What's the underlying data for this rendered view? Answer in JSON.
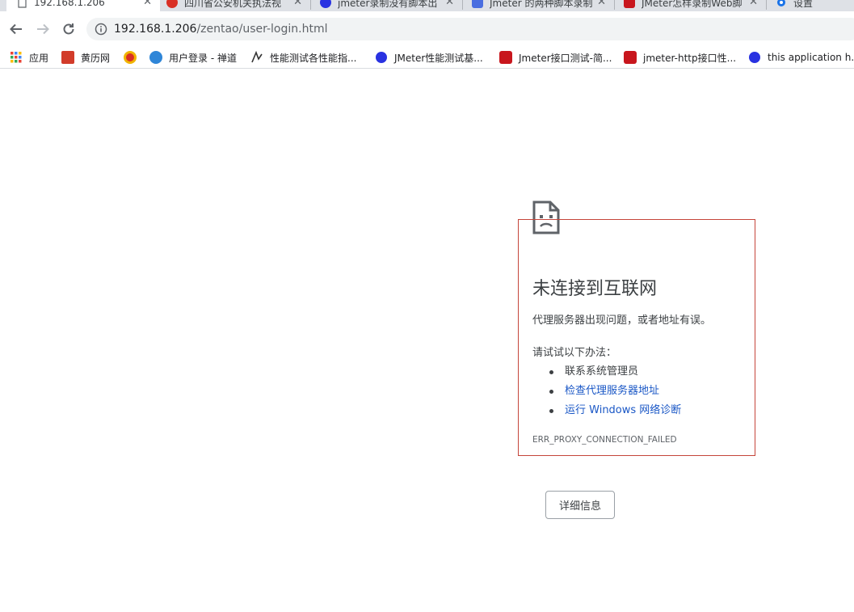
{
  "tabs": [
    {
      "title": "192.168.1.206",
      "icon": "page-icon",
      "active": true
    },
    {
      "title": "四川省公安机关执法视",
      "icon": "police-badge-icon",
      "active": false
    },
    {
      "title": "jmeter录制没有脚本出",
      "icon": "baidu-paw-icon",
      "active": false
    },
    {
      "title": "Jmeter 的两种脚本录制",
      "icon": "blog-icon",
      "active": false
    },
    {
      "title": "JMeter怎样录制Web脚",
      "icon": "csdn-icon",
      "active": false
    },
    {
      "title": "设置",
      "icon": "gear-icon",
      "active": false
    }
  ],
  "tab_close_glyph": "✕",
  "address": {
    "host": "192.168.1.206",
    "path": "/zentao/user-login.html"
  },
  "bookmarks": [
    {
      "label": "应用",
      "icon": "apps-grid-icon"
    },
    {
      "label": "黄历网",
      "icon": "calendar-icon"
    },
    {
      "label": "",
      "icon": "police-badge-icon"
    },
    {
      "label": "用户登录 - 禅道",
      "icon": "zentao-icon"
    },
    {
      "label": "性能测试各性能指...",
      "icon": "bookmark-logo-icon"
    },
    {
      "label": "JMeter性能测试基...",
      "icon": "baidu-paw-icon"
    },
    {
      "label": "Jmeter接口测试-简...",
      "icon": "csdn-icon"
    },
    {
      "label": "jmeter-http接口性...",
      "icon": "csdn-icon"
    },
    {
      "label": "this application h...",
      "icon": "baidu-paw-icon"
    }
  ],
  "error": {
    "title": "未连接到互联网",
    "description": "代理服务器出现问题，或者地址有误。",
    "try_label": "请试试以下办法：",
    "suggestions": [
      {
        "text": "联系系统管理员",
        "link": false
      },
      {
        "text": "检查代理服务器地址",
        "link": true
      },
      {
        "text": "运行 Windows 网络诊断",
        "link": true
      }
    ],
    "code": "ERR_PROXY_CONNECTION_FAILED",
    "details_button": "详细信息"
  },
  "colors": {
    "link": "#1a57c6",
    "error_border": "#c5453a",
    "csdn_red": "#c8161d",
    "baidu_blue": "#2932e1"
  }
}
